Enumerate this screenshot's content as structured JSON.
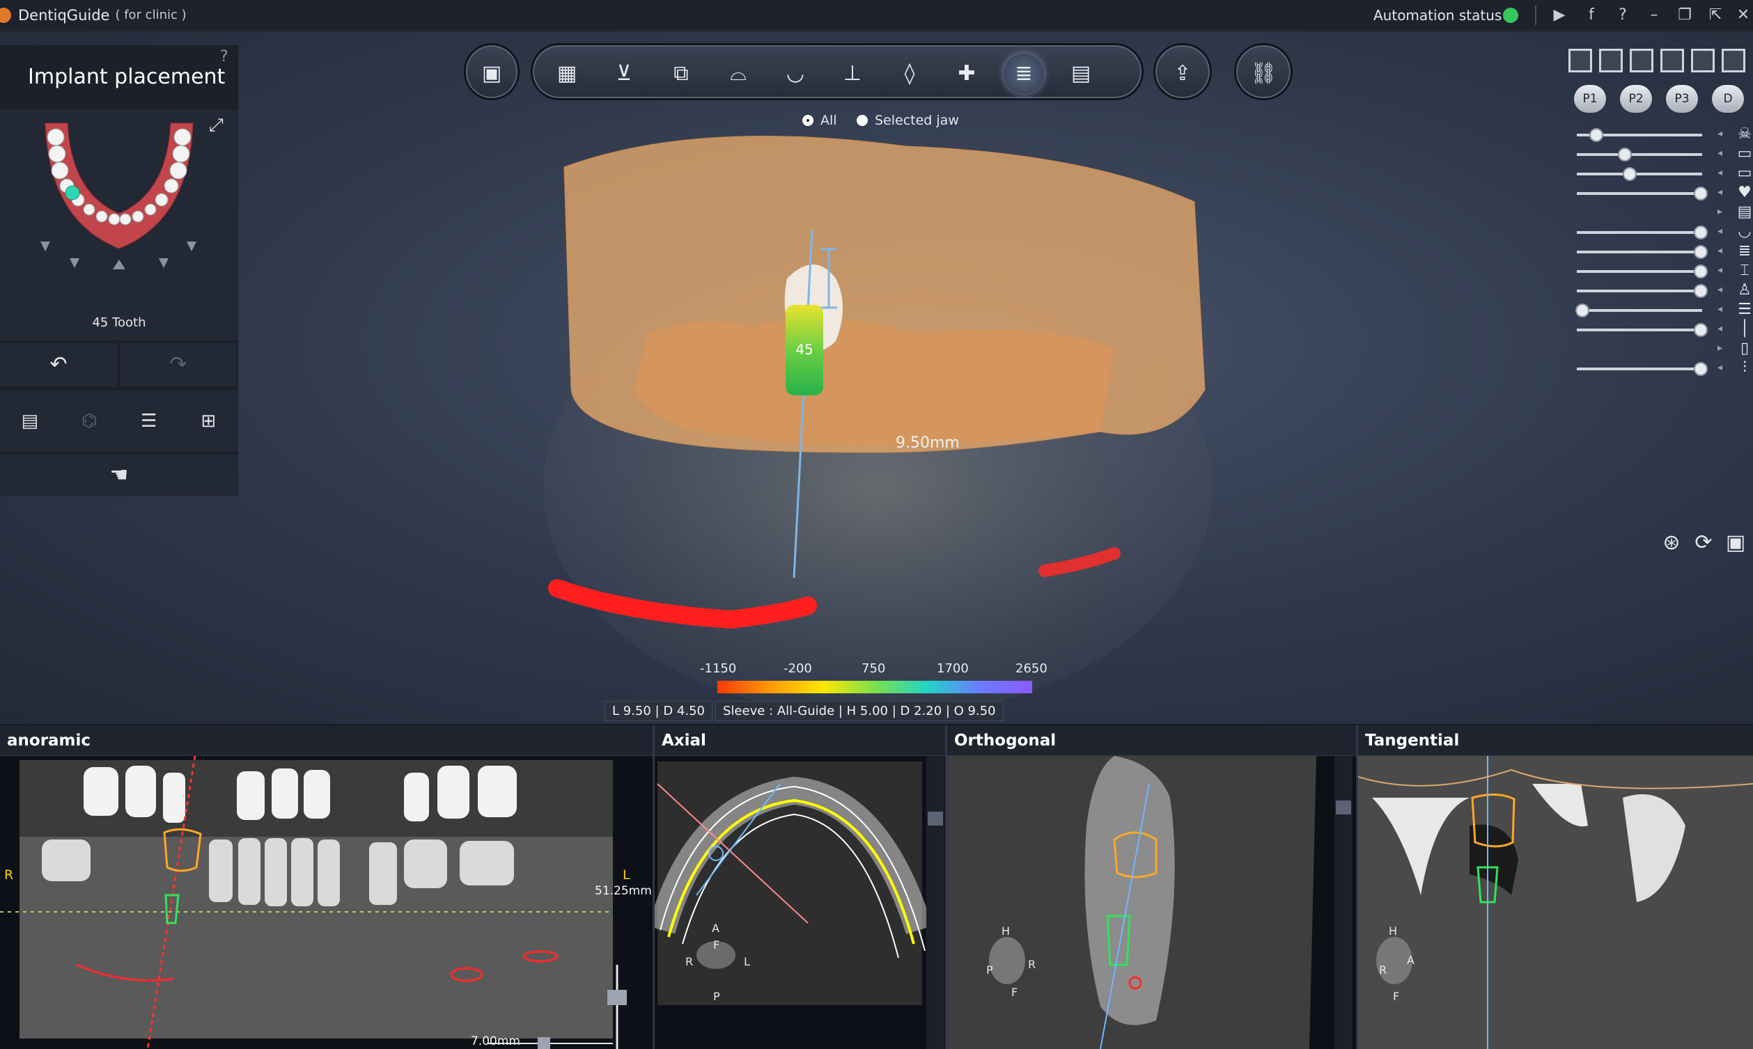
{
  "app": {
    "name": "DentiqGuide",
    "subtitle": "( for clinic )",
    "automation_label": "Automation status :",
    "automation_color": "#34c759"
  },
  "titlebar_icons": [
    "youtube-icon",
    "facebook-icon",
    "help-icon",
    "minimize-icon",
    "restore-icon",
    "popout-icon",
    "close-icon"
  ],
  "left_panel": {
    "title": "Implant placement",
    "help": "?",
    "tooth_label": "45 Tooth",
    "selected_tooth_color": "#2fd6b4"
  },
  "toolbar": {
    "groups": [
      {
        "items": [
          "patient-info"
        ]
      },
      {
        "items": [
          "scan-alignment",
          "crown-lower",
          "volume-crop",
          "panoramic-curve",
          "jaw-model",
          "prosthesis",
          "tooth-outline",
          "tooth-add",
          "implant",
          "report"
        ],
        "active": "implant"
      },
      {
        "items": [
          "export"
        ]
      },
      {
        "items": [
          "link"
        ]
      }
    ]
  },
  "jaw_options": {
    "all": "All",
    "selected": "Selected jaw",
    "checked": "all"
  },
  "scene": {
    "measure": "9.50mm",
    "implant_number": "45"
  },
  "colorbar": {
    "labels": [
      "-1150",
      "-200",
      "750",
      "1700",
      "2650"
    ]
  },
  "info": {
    "implant": "L 9.50 | D 4.50",
    "sleeve": "Sleeve : All-Guide | H 5.00 | D 2.20 | O 9.50"
  },
  "right_panel": {
    "presets": [
      "P1",
      "P2",
      "P3",
      "D"
    ],
    "sliders": [
      {
        "icon": "skull-icon",
        "level": 0.12
      },
      {
        "icon": "upper-teeth-icon",
        "level": 0.36
      },
      {
        "icon": "lower-teeth-icon",
        "level": 0.4
      },
      {
        "icon": "tooth-icon",
        "level": 1.0
      },
      {
        "icon": "jaw-scan-icon",
        "level": null
      },
      {
        "icon": "lower-jaw-icon",
        "level": 1.0
      },
      {
        "icon": "implant-icon",
        "level": 1.0
      },
      {
        "icon": "abutment-icon",
        "level": 1.0
      },
      {
        "icon": "crown-icon",
        "level": 1.0
      },
      {
        "icon": "guide-icon",
        "level": 0.0
      },
      {
        "icon": "drill-icon",
        "level": 1.0
      },
      {
        "icon": "sleeve-icon",
        "level": null
      },
      {
        "icon": "nerve-icon",
        "level": 1.0
      }
    ]
  },
  "views": {
    "panoramic": {
      "title": "anoramic",
      "mm": "51.25mm",
      "scale": "7.00mm",
      "left": "R",
      "right": "L"
    },
    "axial": {
      "title": "Axial",
      "a": "A",
      "f": "F",
      "r": "R",
      "l": "L",
      "p": "P"
    },
    "orthogonal": {
      "title": "Orthogonal",
      "h": "H",
      "p": "P",
      "r": "R",
      "f": "F"
    },
    "tangential": {
      "title": "Tangential",
      "h": "H",
      "r": "R",
      "a": "A",
      "f": "F"
    }
  }
}
